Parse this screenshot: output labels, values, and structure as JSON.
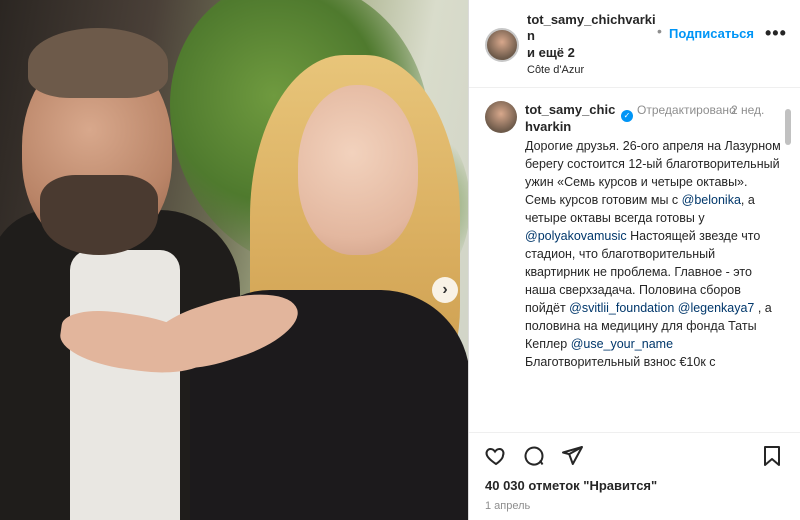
{
  "post": {
    "username": "tot_samy_chichvarkin",
    "and_more": "и ещё 2",
    "location": "Côte d'Azur",
    "follow_label": "Подписаться",
    "follow_dot": "•",
    "more_glyph": "•••"
  },
  "caption": {
    "username": "tot_samy_chichvarkin",
    "edited": "Отредактировано",
    "time": "2 нед.",
    "line1": "Дорогие друзья. 26-ого апреля на Лазурном берегу состоится 12-ый благотворительный ужин «Семь курсов и четыре октавы».",
    "line2a": "Семь курсов готовим мы с ",
    "mention1": "@belonika",
    "line2b": ", а четыре октавы всегда готовы у ",
    "mention2": "@polyakovamusic",
    "line2c": " Настоящей звезде что стадион, что благотворительный квартирник не проблема. Главное - это наша сверхзадача. Половина сборов пойдёт ",
    "mention3": "@svitlii_foundation",
    "line2d": " ",
    "mention4": "@legenkaya7",
    "line2e": " , а половина на медицину для фонда Таты Кеплер ",
    "mention5": "@use_your_name",
    "line3": "Благотворительный взнос €10к с"
  },
  "stats": {
    "likes": "40 030 отметок \"Нравится\"",
    "date": "1 апрель"
  },
  "icons": [
    "heart-icon",
    "comment-icon",
    "share-icon",
    "bookmark-icon",
    "chevron-right-icon",
    "verified-icon",
    "more-icon"
  ],
  "colors": {
    "link": "#0095f6",
    "mention": "#00376b",
    "muted": "#8e8e8e"
  }
}
